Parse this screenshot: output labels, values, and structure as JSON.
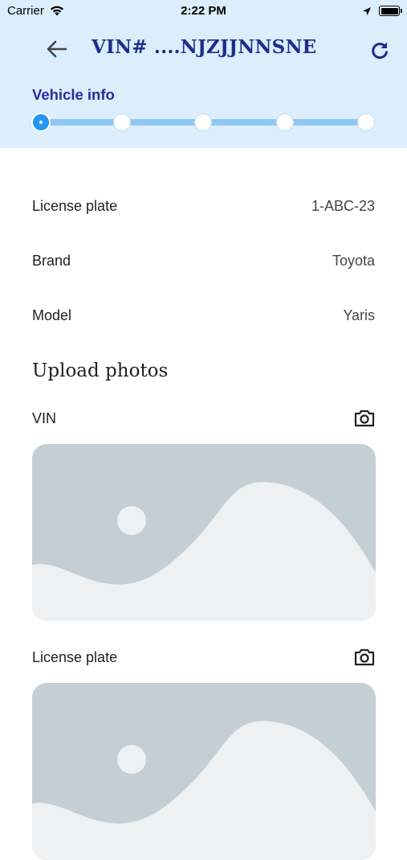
{
  "status_bar": {
    "carrier": "Carrier",
    "time": "2:22 PM"
  },
  "header": {
    "title": "VIN# ....NJZJJNNSNE",
    "step_label": "Vehicle info",
    "steps_total": 5,
    "current_step": 1
  },
  "vehicle": {
    "license_plate_label": "License plate",
    "license_plate_value": "1-ABC-23",
    "brand_label": "Brand",
    "brand_value": "Toyota",
    "model_label": "Model",
    "model_value": "Yaris"
  },
  "upload": {
    "title": "Upload photos",
    "photos": [
      {
        "label": "VIN",
        "icon": "camera-icon"
      },
      {
        "label": "License plate",
        "icon": "camera-icon"
      }
    ]
  },
  "icons": {
    "back": "arrow-left-icon",
    "refresh": "refresh-icon"
  },
  "colors": {
    "header_bg": "#dcedfb",
    "title": "#1d2c8f",
    "accent": "#2196f3",
    "track": "#8fc7f4"
  }
}
